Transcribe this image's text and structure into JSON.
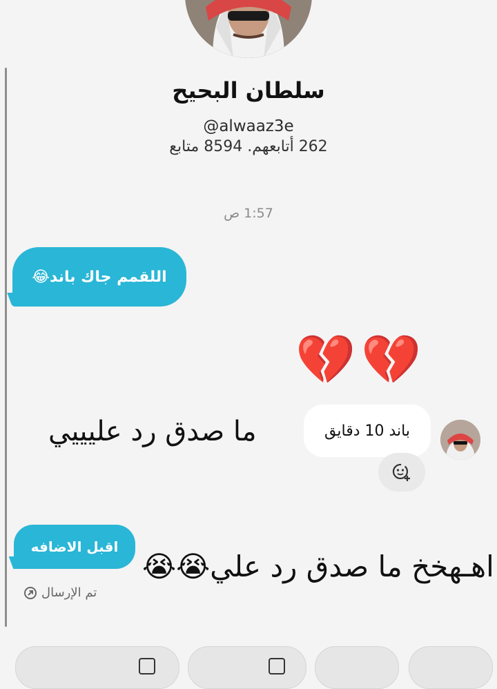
{
  "profile": {
    "name": "سلطان البحيح",
    "handle": "@alwaaz3e",
    "stats": "262 أتابعهم. 8594 متابع"
  },
  "chat": {
    "timestamp": "1:57 ص",
    "msg_out_1": "اللقمم جاك باند😂",
    "hearts": "💔💔",
    "overlay_1": "ما صدق رد عليييي",
    "reply_in": "باند 10 دقايق",
    "msg_out_2": "اقبل الاضافه",
    "overlay_2": "اهـهخخ ما صدق رد علي😭😭",
    "sent_status": "تم الإرسال"
  },
  "icons": {
    "reaction": "add-reaction-icon",
    "sent": "arrow-circle-icon"
  },
  "colors": {
    "accent": "#2ab6d6"
  }
}
